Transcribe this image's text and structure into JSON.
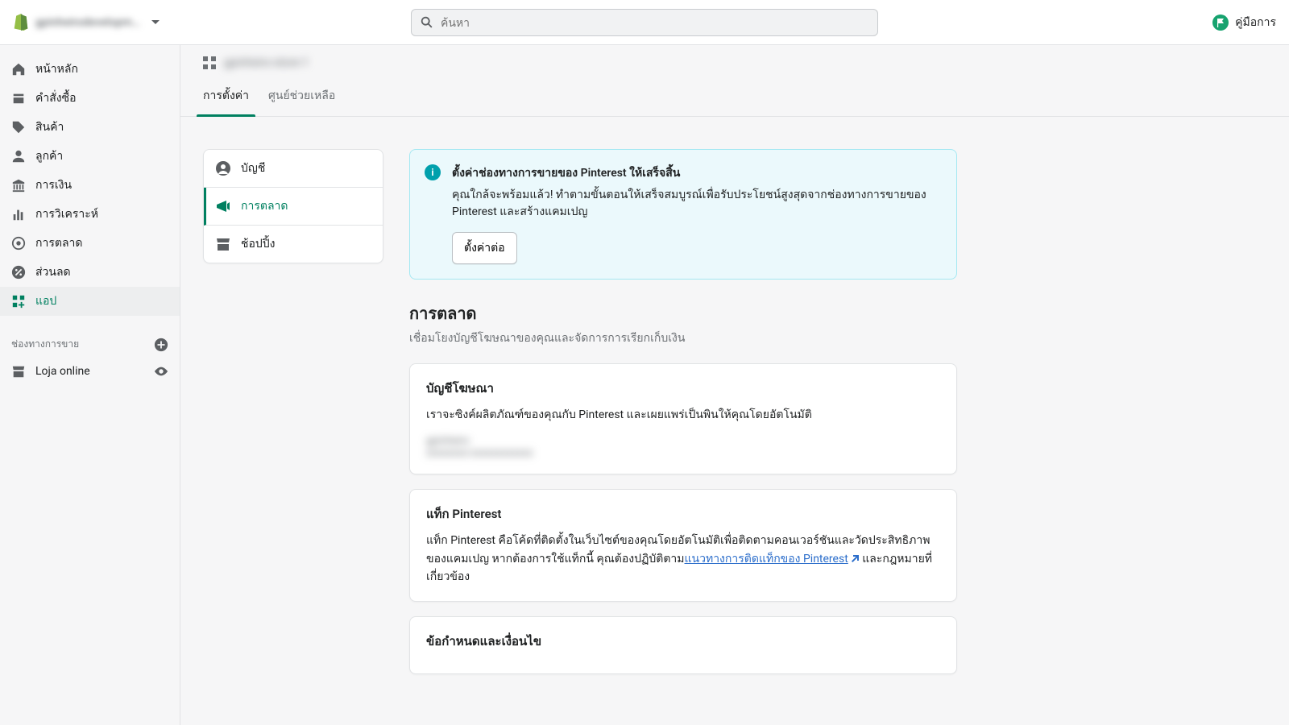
{
  "header": {
    "store_name": "gpinheirodevelopm…",
    "search_placeholder": "ค้นหา",
    "guide_label": "คู่มือการ"
  },
  "nav": {
    "home": "หน้าหลัก",
    "orders": "คำสั่งซื้อ",
    "products": "สินค้า",
    "customers": "ลูกค้า",
    "finances": "การเงิน",
    "analytics": "การวิเคราะห์",
    "marketing": "การตลาด",
    "discounts": "ส่วนลด",
    "apps": "แอป"
  },
  "channels": {
    "heading": "ช่องทางการขาย",
    "online_store": "Loja online"
  },
  "breadcrumb": {
    "app_name": "gpinheiro-store-1"
  },
  "tabs": {
    "settings": "การตั้งค่า",
    "help": "ศูนย์ช่วยเหลือ"
  },
  "subnav": {
    "account": "บัญชี",
    "marketing": "การตลาด",
    "shopping": "ช้อปปิ้ง"
  },
  "banner": {
    "title": "ตั้งค่าช่องทางการขายของ Pinterest ให้เสร็จสิ้น",
    "description": "คุณใกล้จะพร้อมแล้ว! ทำตามขั้นตอนให้เสร็จสมบูรณ์เพื่อรับประโยชน์สูงสุดจากช่องทางการขายของ Pinterest และสร้างแคมเปญ",
    "button": "ตั้งค่าต่อ"
  },
  "marketing_section": {
    "title": "การตลาด",
    "subtitle": "เชื่อมโยงบัญชีโฆษณาของคุณและจัดการการเรียกเก็บเงิน"
  },
  "ad_account_card": {
    "title": "บัญชีโฆษณา",
    "text": "เราจะซิงค์ผลิตภัณฑ์ของคุณกับ Pinterest และเผยแพร่เป็นพินให้คุณโดยอัตโนมัติ",
    "account_name": "gpinheiro",
    "account_detail": "xxxxxxxx-xxxxxxxxxxxx"
  },
  "tag_card": {
    "title": "แท็ก Pinterest",
    "text_before": "แท็ก Pinterest คือโค้ดที่ติดตั้งในเว็บไซต์ของคุณโดยอัตโนมัติเพื่อติดตามคอนเวอร์ชันและวัดประสิทธิภาพของแคมเปญ หากต้องการใช้แท็กนี้ คุณต้องปฏิบัติตาม",
    "link": "แนวทางการติดแท็กของ Pinterest",
    "text_after": "และกฎหมายที่เกี่ยวข้อง"
  },
  "terms_card": {
    "title": "ข้อกำหนดและเงื่อนไข"
  }
}
